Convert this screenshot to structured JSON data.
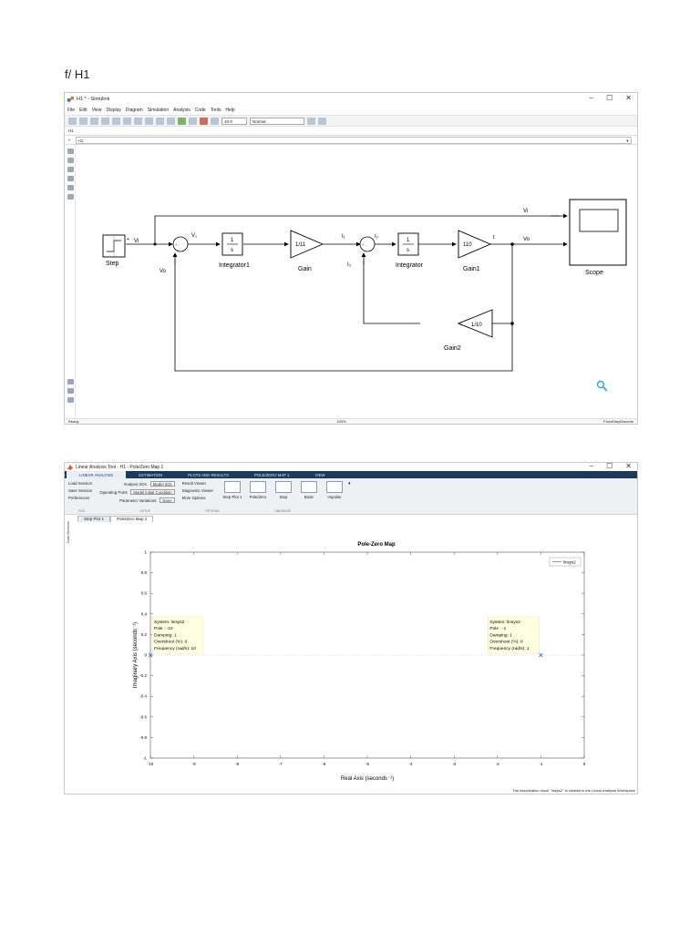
{
  "page_heading": "f/ H1",
  "simulink": {
    "title": "H1 * - Simulink",
    "window_controls": [
      "–",
      "☐",
      "✕"
    ],
    "menu": [
      "File",
      "Edit",
      "View",
      "Display",
      "Diagram",
      "Simulation",
      "Analysis",
      "Code",
      "Tools",
      "Help"
    ],
    "sim_time": "10.0",
    "sim_mode": "Normal",
    "crumb": "H1",
    "address": "H1",
    "status_left": "Ready",
    "status_mid": "100%",
    "status_right": "FixedStepDiscrete",
    "blocks": {
      "step": "Step",
      "integrator1_num": "1",
      "integrator1_den": "s",
      "integrator1": "Integrator1",
      "gain": "Gain",
      "gain_value": "1/11",
      "integrator_num": "1",
      "integrator_den": "s",
      "integrator": "Integrator",
      "gain1": "Gain1",
      "gain1_value": "110",
      "gain2": "Gain2",
      "gain2_value": "1/10",
      "scope": "Scope"
    },
    "signals": {
      "vi_step": "Vi",
      "vi_top": "Vi",
      "v1": "V₁",
      "vo_bottom": "Vo",
      "i1": "I₁",
      "i2": "I₂",
      "i3": "I₃",
      "t": "t",
      "vo": "Vo"
    },
    "step_port": "+",
    "sum1_signs": "+ -",
    "sum2_signs": "+ -"
  },
  "lti": {
    "title": "Linear Analysis Tool - H1 - Pole/Zero Map 1",
    "tabs": [
      "LINEAR ANALYSIS",
      "ESTIMATION",
      "PLOTS AND RESULTS",
      "POLE/ZERO MAP 1",
      "VIEW"
    ],
    "file_buttons": [
      "Load Session",
      "Save Session",
      "Preferences"
    ],
    "analysis_ios_label": "Analysis I/Os:",
    "analysis_ios_value": "Model I/Os",
    "operating_point_label": "Operating Point:",
    "operating_point_value": "Model Initial Condition",
    "param_var_label": "Parameter Variations:",
    "param_var_value": "None",
    "options": [
      "Result Viewer",
      "Diagnostic Viewer",
      "More Options"
    ],
    "plot_buttons": [
      "Step Plot 1",
      "Pole/Zero",
      "Step",
      "Bode",
      "Impulse"
    ],
    "group_labels": [
      "FILE",
      "SETUP",
      "OPTIONS",
      "LINEARIZE"
    ],
    "doc_tabs": [
      "Step Plot 1",
      "Pole/Zero Map 1"
    ],
    "dock_label": "Data Browser",
    "status": "The linearization result \"linsys2\" is created in the Linear Analysis Workspace"
  },
  "chart_data": {
    "type": "scatter",
    "title": "Pole-Zero Map",
    "xlabel": "Real Axis (seconds⁻¹)",
    "ylabel": "Imaginary Axis (seconds⁻¹)",
    "xlim": [
      -10,
      0
    ],
    "ylim": [
      -1,
      1
    ],
    "xticks": [
      -10,
      -9,
      -8,
      -7,
      -6,
      -5,
      -4,
      -3,
      -2,
      -1,
      0
    ],
    "yticks": [
      -1,
      -0.8,
      -0.6,
      -0.4,
      -0.2,
      0,
      0.2,
      0.4,
      0.6,
      0.8,
      1
    ],
    "grid": false,
    "legend": [
      "linsys2"
    ],
    "legend_position": "top-right",
    "series": [
      {
        "name": "linsys2",
        "marker": "x",
        "x": [
          -10,
          -1
        ],
        "y": [
          0,
          0
        ]
      }
    ],
    "datatips": [
      {
        "lines": [
          "System: linsys2",
          "Pole : -10",
          "Damping: 1",
          "Overshoot (%): 0",
          "Frequency (rad/s): 10"
        ]
      },
      {
        "lines": [
          "System: linsys2",
          "Pole : -1",
          "Damping: 1",
          "Overshoot (%): 0",
          "Frequency (rad/s): 1"
        ]
      }
    ],
    "colors": {
      "series": "#1f5fbf",
      "tip_bg": "#ffffe1"
    }
  }
}
